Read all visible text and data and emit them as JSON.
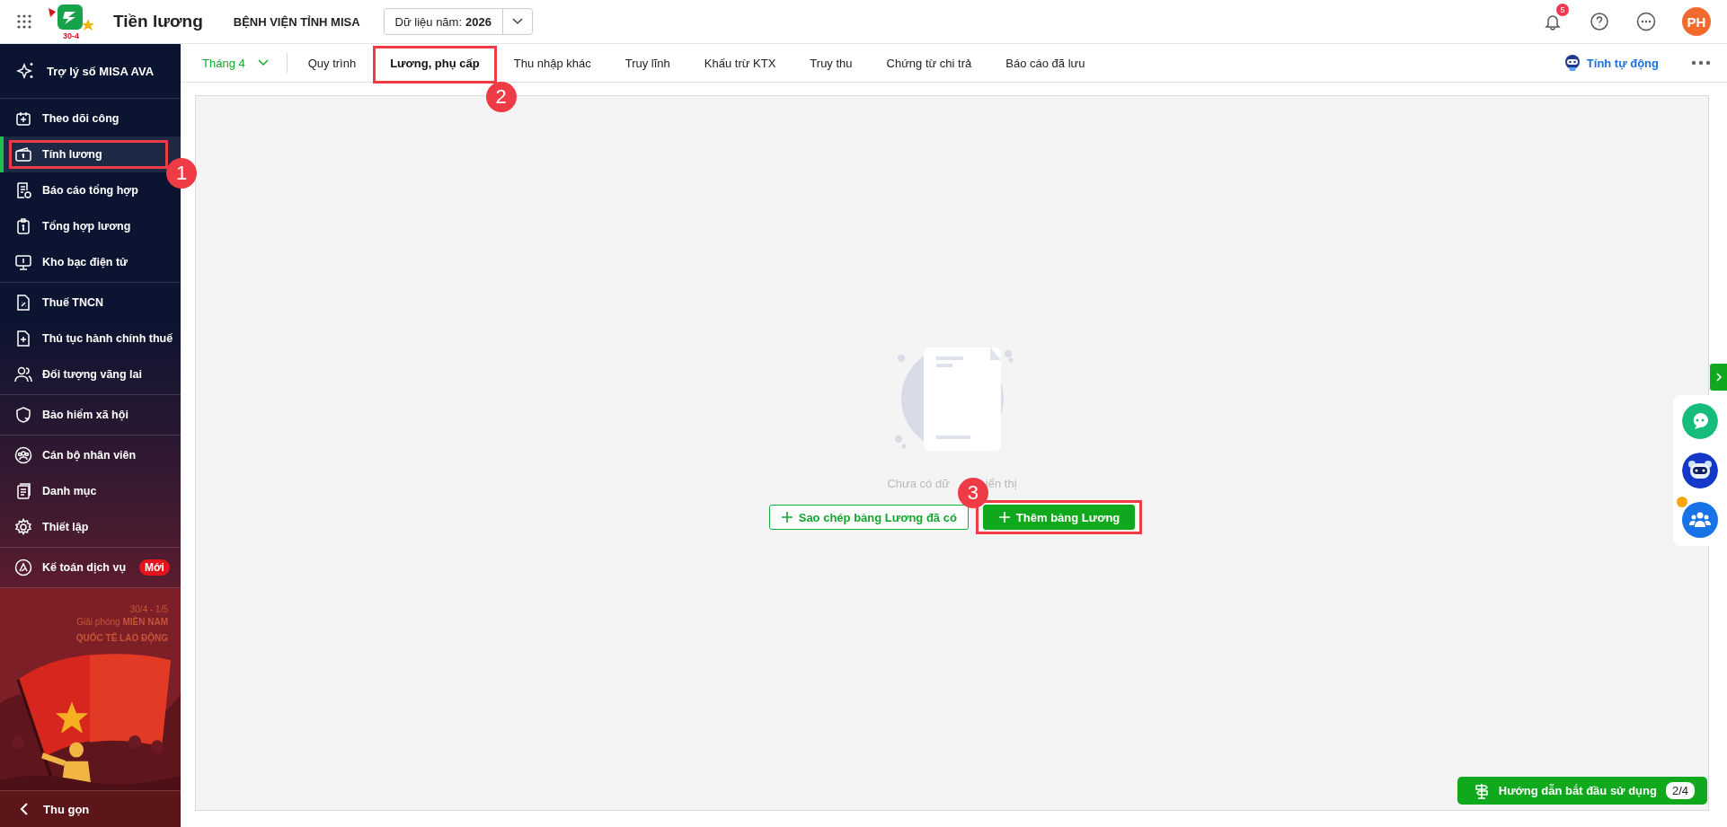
{
  "header": {
    "logo_text": "30-4",
    "title": "Tiền lương",
    "org": "BỆNH VIỆN TỈNH MISA",
    "year_label": "Dữ liệu năm:",
    "year": "2026",
    "notifications": "5",
    "avatar": "PH"
  },
  "sidebar": {
    "assistant": "Trợ lý số MISA AVA",
    "groups": [
      [
        {
          "label": "Theo dõi công",
          "selected": false
        },
        {
          "label": "Tính lương",
          "selected": true,
          "callout": "1"
        },
        {
          "label": "Báo cáo tổng hợp",
          "selected": false
        },
        {
          "label": "Tổng hợp lương",
          "selected": false
        },
        {
          "label": "Kho bạc điện tử",
          "selected": false
        }
      ],
      [
        {
          "label": "Thuế TNCN",
          "selected": false
        },
        {
          "label": "Thủ tục hành chính thuế",
          "selected": false
        },
        {
          "label": "Đối tượng vãng lai",
          "selected": false
        }
      ],
      [
        {
          "label": "Bảo hiểm xã hội",
          "selected": false
        }
      ],
      [
        {
          "label": "Cán bộ nhân viên",
          "selected": false
        },
        {
          "label": "Danh mục",
          "selected": false
        },
        {
          "label": "Thiết lập",
          "selected": false
        }
      ],
      [
        {
          "label": "Kế toán dịch vụ",
          "selected": false,
          "badge": "Mới"
        }
      ]
    ],
    "banner": {
      "dates": "30/4 - 1/5",
      "headline": "Giải phóng **MIỀN NAM**",
      "subline": "QUỐC TẾ LAO ĐỘNG"
    },
    "collapse": "Thu gọn"
  },
  "tabbar": {
    "month": "Tháng 4",
    "tabs": [
      {
        "label": "Quy trình",
        "selected": false
      },
      {
        "label": "Lương, phụ cấp",
        "selected": true,
        "callout": "2"
      },
      {
        "label": "Thu nhập khác",
        "selected": false
      },
      {
        "label": "Truy lĩnh",
        "selected": false
      },
      {
        "label": "Khấu trừ KTX",
        "selected": false
      },
      {
        "label": "Truy thu",
        "selected": false
      },
      {
        "label": "Chứng từ chi trả",
        "selected": false
      },
      {
        "label": "Báo cáo đã lưu",
        "selected": false
      }
    ],
    "auto": "Tính tự động"
  },
  "empty": {
    "message_parts": [
      "Chưa có dữ",
      "iển thị"
    ],
    "buttons": [
      {
        "kind": "outline",
        "label": "Sao chép bảng Lương đã có"
      },
      {
        "kind": "primary",
        "label": "Thêm bảng Lương",
        "callout": "3"
      }
    ]
  },
  "guide": {
    "label": "Hướng dẫn bắt đầu sử dụng",
    "progress": "2/4"
  }
}
